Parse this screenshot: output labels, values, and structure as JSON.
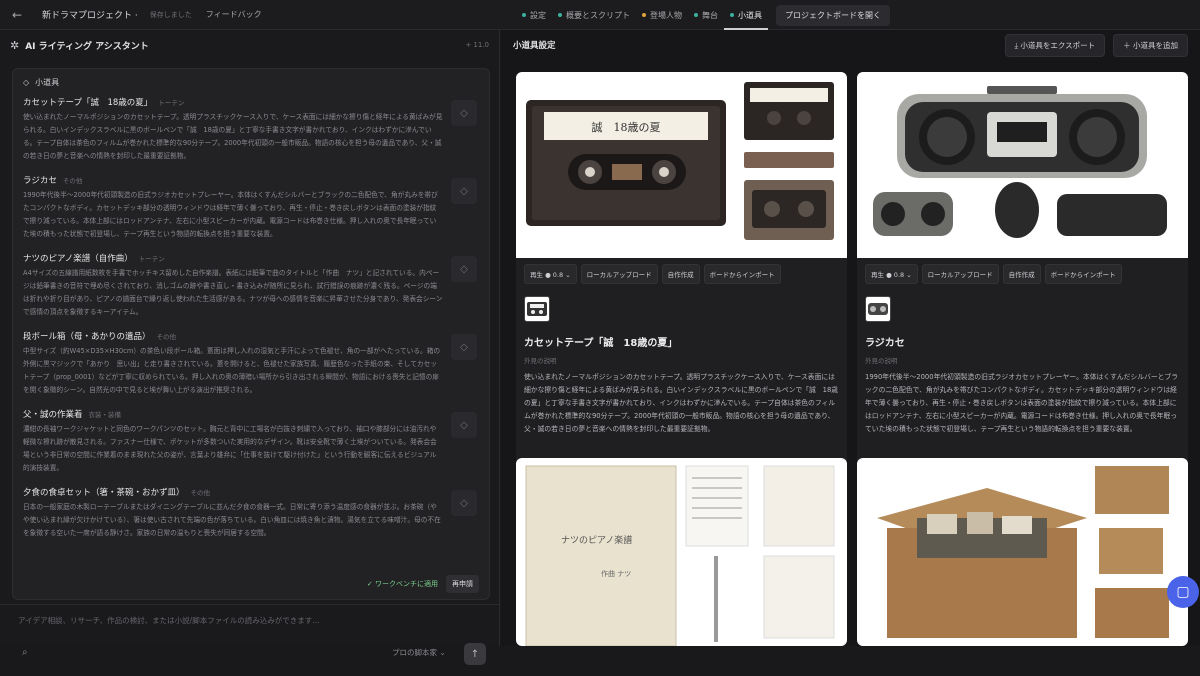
{
  "topbar": {
    "back_icon": "arrow-left-icon",
    "project_title": "新ドラマプロジェクト ·",
    "saved_status": "保存しました",
    "feedback": "フィードバック",
    "tabs": [
      {
        "label": "設定",
        "dot": "#3bb0a0"
      },
      {
        "label": "概要とスクリプト",
        "dot": "#3bb0a0"
      },
      {
        "label": "登場人物",
        "dot": "#e0a23c"
      },
      {
        "label": "舞台",
        "dot": "#3bb0a0"
      },
      {
        "label": "小道具",
        "dot": "#3bb0a0"
      }
    ],
    "open_board": "プロジェクトボードを開く"
  },
  "assistant": {
    "title": "AI ライティング アシスタント",
    "version": "+ 11.0",
    "section_label": "小道具",
    "items": [
      {
        "title": "カセットテープ「誠　18歳の夏」",
        "tag": "トーテン",
        "desc": "使い込まれたノーマルポジションのカセットテープ。透明プラスチックケース入りで、ケース表面には細かな擦り傷と経年による黄ばみが見られる。白いインデックスラベルに黒のボールペンで「誠　18歳の夏」と丁寧な手書き文字が書かれており、インクはわずかに滲んでいる。テープ自体は茶色のフィルムが巻かれた標準的な90分テープ。2000年代初頭の一般市販品。物語の核心を担う母の遺品であり、父・誠の若き日の夢と音楽への情熱を封印した最重要証拠物。"
      },
      {
        "title": "ラジカセ",
        "tag": "その他",
        "desc": "1990年代後半〜2000年代初頭製造の旧式ラジオカセットプレーヤー。本体はくすんだシルバーとブラックの二色配色で、角が丸みを帯びたコンパクトなボディ。カセットデッキ部分の透明ウィンドウは経年で薄く曇っており、再生・停止・巻き戻しボタンは表面の塗装が指紋で擦り減っている。本体上部にはロッドアンテナ、左右に小型スピーカーが内蔵。電源コードは布巻き仕様。押し入れの奥で長年眠っていた埃の積もった状態で初登場し、テープ再生という物語的転換点を担う重要な装置。"
      },
      {
        "title": "ナツのピアノ楽譜（自作曲）",
        "tag": "トーテン",
        "desc": "A4サイズの五線譜用紙数枚を手書でホッチキス留めした自作楽譜。表紙には鉛筆で曲のタイトルと「作曲　ナツ」と記されている。内ページは鉛筆書きの音符で埋め尽くされており、消しゴムの跡や書き直し・書き込みが随所に見られ、試行錯誤の痕跡が濃く残る。ページの端は折れや折り目があり、ピアノの譜面台で繰り返し使われた生活感がある。ナツが母への感情を音楽に昇華させた分身であり、発表会シーンで感情の頂点を象徴するキーアイテム。"
      },
      {
        "title": "段ボール箱（母・あかりの遺品）",
        "tag": "その他",
        "desc": "中型サイズ（約W45×D35×H30cm）の茶色い段ボール箱。蓋面は押し入れの湿気と手汗によって色褪せ、角の一部がへたっている。箱の外側に黒マジックで「あかり　思い出」と走り書きされている。蓋を開けると、色褪せた家族写真、履歴色なった手紙の束、そしてカセットテープ（prop_0001）などが丁寧に収められている。押し入れの奥の薄暗い場所から引き出される瞬間が、物語における喪失と記憶の扉を開く象徴的シーン。自然光の中で見ると埃が舞い上がる演出が推奨される。"
      },
      {
        "title": "父・誠の作業着",
        "tag": "衣装・装備",
        "desc": "濃紺の長袖ワークジャケットと同色のワークパンツのセット。胸元と背中に工場名が白抜き刺繍で入っており、袖口や膝部分には油汚れや軽微な擦れ跡が散見される。ファスナー仕様で、ポケットが多数ついた実用的なデザイン。靴は安全靴で薄く土埃がついている。発表会会場という非日常の空間に作業着のまま現れた父の姿が、言葉より雄弁に「仕事を抜けて駆け付けた」という行動を観客に伝えるビジュアル的演技装置。"
      },
      {
        "title": "夕食の食卓セット（箸・茶碗・おかず皿）",
        "tag": "その他",
        "desc": "日本の一般家庭の木製ローテーブルまたはダイニングテーブルに並んだ夕食の食器一式。日常に寄り添う温度感の食器が並ぶ。お茶碗（やや使い込まれ縁が欠けかけている）、箸は使い古されて先端の色が落ちている。白い角皿には焼き魚と漬物。湯気を立てる味噌汁。母の不在を象徴する空いた一席が語る静けさ。家族の日常の温もりと喪失が同居する空間。"
      }
    ],
    "applied": "✓ ワークベンチに適用",
    "reapply": "再申請",
    "input_placeholder": "アイデア相談、リサーチ、作品の検討、または小説/脚本ファイルの読み込みができます...",
    "pro_script": "プロの脚本家 ⌄",
    "send_icon": "arrow-up-icon"
  },
  "props_panel": {
    "title": "小道具設定",
    "export_button": "小道具をエクスポート",
    "add_button": "小道具を追加",
    "toolbar": {
      "replay": "再生 ● 0.8 ⌄",
      "local_upload": "ローカルアップロード",
      "self_create": "自作作成",
      "board_import": "ボードからインポート"
    },
    "cards": [
      {
        "name": "カセットテープ「誠　18歳の夏」",
        "sub": "外見の説明",
        "desc": "使い込まれたノーマルポジションのカセットテープ。透明プラスチックケース入りで、ケース表面には細かな擦り傷と経年による黄ばみが見られる。白いインデックスラベルに黒のボールペンで「誠　18歳の夏」と丁寧な手書き文字が書かれており、インクはわずかに滲んでいる。テープ自体は茶色のフィルムが巻かれた標準的な90分テープ。2000年代初頭の一般市販品。物語の核心を担う母の遺品であり、父・誠の若き日の夢と音楽への情熱を封印した最重要証拠物。"
      },
      {
        "name": "ラジカセ",
        "sub": "外見の説明",
        "desc": "1990年代後半〜2000年代初頭製造の旧式ラジオカセットプレーヤー。本体はくすんだシルバーとブラックの二色配色で、角が丸みを帯びたコンパクトなボディ。カセットデッキ部分の透明ウィンドウは経年で薄く曇っており、再生・停止・巻き戻しボタンは表面の塗装が指紋で擦り減っている。本体上部にはロッドアンテナ、左右に小型スピーカーが内蔵。電源コードは布巻き仕様。押し入れの奥で長年眠っていた埃の積もった状態で初登場し、テープ再生という物語的転換点を担う重要な装置。"
      }
    ],
    "cassette_label_text": "誠　18歳の夏",
    "score_title_text": "ナツのピアノ楽譜",
    "score_composer_text": "作曲 ナツ"
  }
}
